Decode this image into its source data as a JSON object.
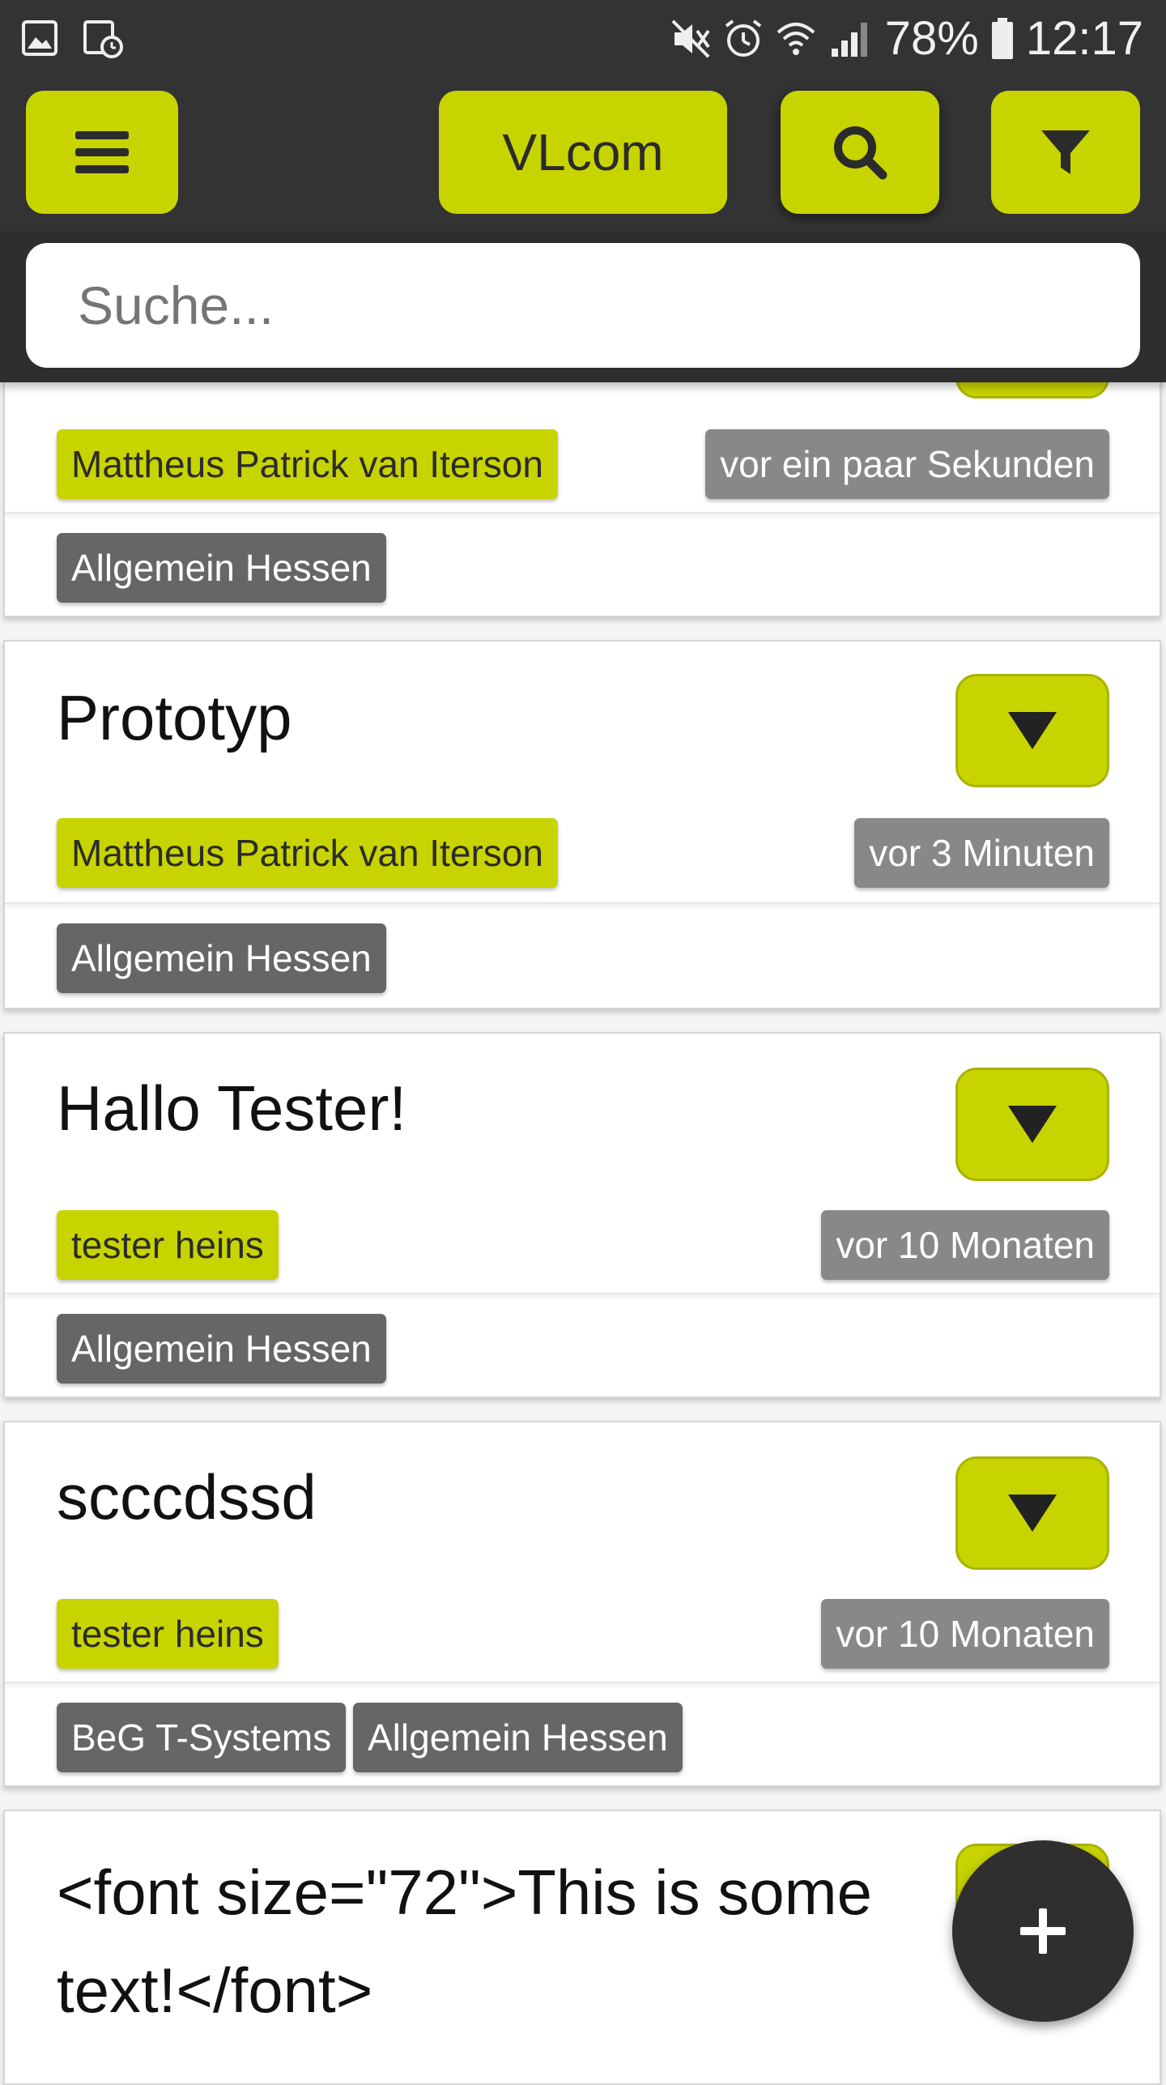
{
  "status_bar": {
    "battery_percent": "78%",
    "time": "12:17",
    "left_icons": [
      "image-icon",
      "calendar-clock-icon"
    ],
    "right_icons": [
      "mute-icon",
      "alarm-icon",
      "wifi-icon",
      "signal-icon",
      "battery-icon"
    ]
  },
  "toolbar": {
    "title": "VLcom",
    "menu_icon": "menu-icon",
    "search_icon": "search-icon",
    "filter_icon": "filter-icon"
  },
  "search": {
    "placeholder": "Suche..."
  },
  "cards": [
    {
      "title": "",
      "author": "Mattheus Patrick van Iterson",
      "time": "vor ein paar Sekunden",
      "groups": [
        "Allgemein Hessen"
      ]
    },
    {
      "title": "Prototyp",
      "author": "Mattheus Patrick van Iterson",
      "time": "vor 3 Minuten",
      "groups": [
        "Allgemein Hessen"
      ]
    },
    {
      "title": "Hallo Tester!",
      "author": "tester heins",
      "time": "vor 10 Monaten",
      "groups": [
        "Allgemein Hessen"
      ]
    },
    {
      "title": "scccdssd",
      "author": "tester heins",
      "time": "vor 10 Monaten",
      "groups": [
        "BeG T-Systems",
        "Allgemein Hessen"
      ]
    },
    {
      "title": "<font size=\"72\">This is some text!</font>"
    }
  ],
  "fab": {
    "label": "+"
  },
  "colors": {
    "accent": "#c8d400",
    "dark": "#333333",
    "time_badge": "#888888",
    "group_badge": "#666666"
  }
}
